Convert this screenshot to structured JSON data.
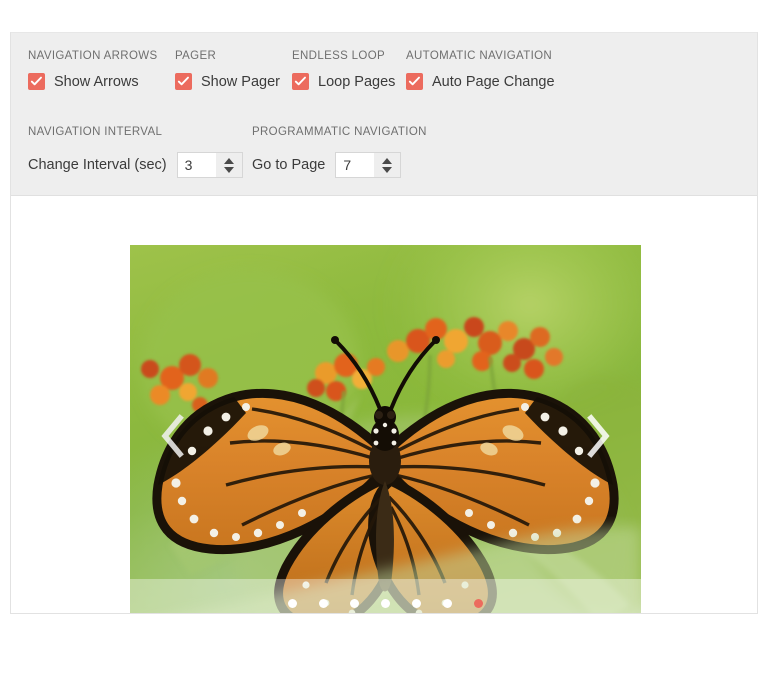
{
  "toolbar": {
    "groups": [
      {
        "id": "navigation-arrows",
        "title": "NAVIGATION ARROWS"
      },
      {
        "id": "pager",
        "title": "PAGER"
      },
      {
        "id": "endless-loop",
        "title": "ENDLESS LOOP"
      },
      {
        "id": "automatic-navigation",
        "title": "AUTOMATIC NAVIGATION"
      },
      {
        "id": "navigation-interval",
        "title": "NAVIGATION INTERVAL"
      },
      {
        "id": "programmatic-navigation",
        "title": "PROGRAMMATIC NAVIGATION"
      }
    ],
    "checkboxes": [
      {
        "id": "show-arrows",
        "label": "Show Arrows",
        "checked": true
      },
      {
        "id": "show-pager",
        "label": "Show Pager",
        "checked": true
      },
      {
        "id": "loop-pages",
        "label": "Loop Pages",
        "checked": true
      },
      {
        "id": "auto-page-change",
        "label": "Auto Page Change",
        "checked": true
      }
    ],
    "spinners": [
      {
        "id": "change-interval",
        "label": "Change Interval (sec)",
        "value": "3"
      },
      {
        "id": "go-to-page",
        "label": "Go to Page",
        "value": "7"
      }
    ]
  },
  "carousel": {
    "prev_arrow_icon": "chevron-left-icon",
    "next_arrow_icon": "chevron-right-icon",
    "slide_alt": "Monarch butterfly on orange milkweed flowers",
    "pager": {
      "total": 7,
      "active_index": 7,
      "dots": [
        1,
        2,
        3,
        4,
        5,
        6,
        7
      ]
    }
  },
  "colors": {
    "accent": "#ec6b5e",
    "toolbar_bg": "#eeeeee",
    "label_text": "#6f6f6f",
    "body_text": "#3b3b3b",
    "card_border": "#e2e2e2"
  }
}
